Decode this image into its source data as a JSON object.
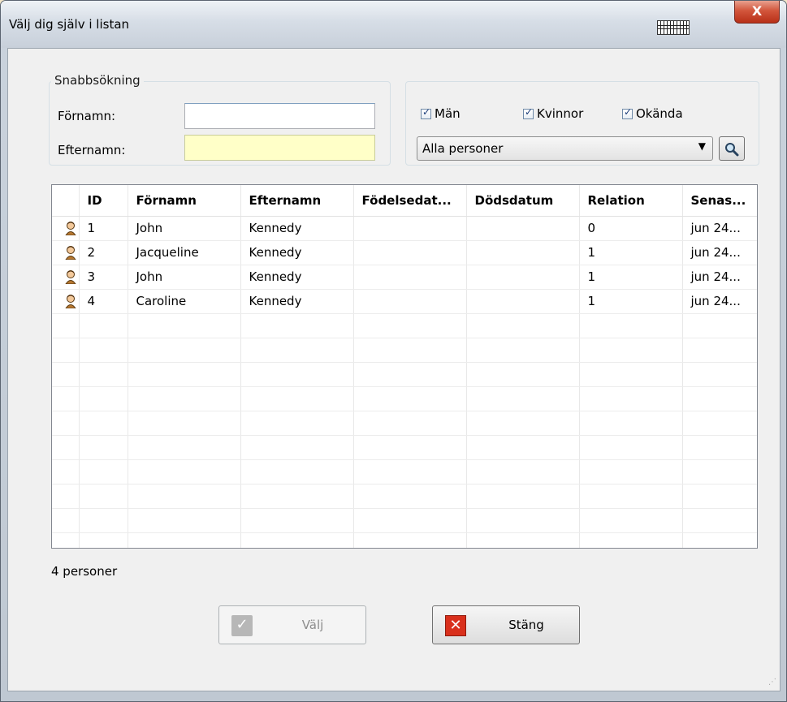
{
  "window": {
    "title": "Välj dig själv i listan",
    "close_label": "X"
  },
  "search": {
    "legend": "Snabbsökning",
    "firstname_label": "Förnamn:",
    "firstname_value": "",
    "lastname_label": "Efternamn:",
    "lastname_value": ""
  },
  "filters": {
    "men_label": "Män",
    "men_checked": true,
    "women_label": "Kvinnor",
    "women_checked": true,
    "unknown_label": "Okända",
    "unknown_checked": true,
    "select_value": "Alla personer"
  },
  "table": {
    "columns": [
      "",
      "ID",
      "Förnamn",
      "Efternamn",
      "Födelsedat...",
      "Dödsdatum",
      "Relation",
      "Senas..."
    ],
    "rows": [
      {
        "id": "1",
        "firstname": "John",
        "lastname": "Kennedy",
        "birth": "",
        "death": "",
        "relation": "0",
        "last": "jun 24..."
      },
      {
        "id": "2",
        "firstname": "Jacqueline",
        "lastname": "Kennedy",
        "birth": "",
        "death": "",
        "relation": "1",
        "last": "jun 24..."
      },
      {
        "id": "3",
        "firstname": "John",
        "lastname": "Kennedy",
        "birth": "",
        "death": "",
        "relation": "1",
        "last": "jun 24..."
      },
      {
        "id": "4",
        "firstname": "Caroline",
        "lastname": "Kennedy",
        "birth": "",
        "death": "",
        "relation": "1",
        "last": "jun 24..."
      }
    ]
  },
  "status": {
    "count_text": "4 personer"
  },
  "buttons": {
    "select_label": "Välj",
    "close_label": "Stäng"
  },
  "colors": {
    "close_button": "#d2553b",
    "yellow_field": "#ffffc8",
    "stop_icon": "#d9301c"
  }
}
